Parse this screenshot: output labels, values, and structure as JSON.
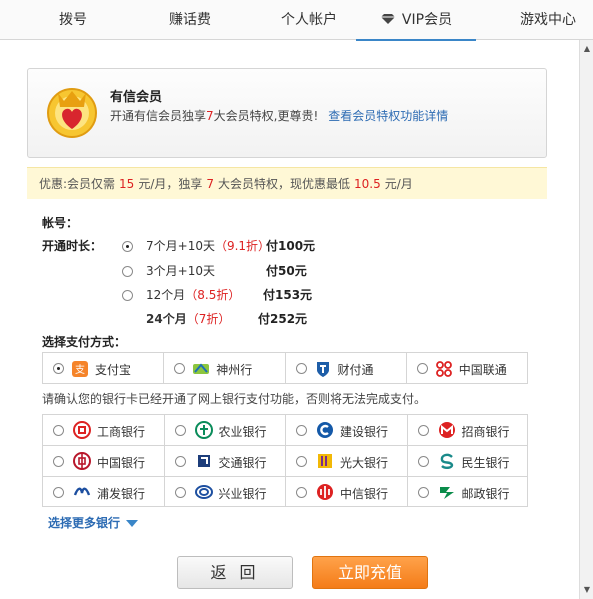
{
  "tabs": [
    {
      "label": "拨号"
    },
    {
      "label": "赚话费"
    },
    {
      "label": "个人帐户"
    },
    {
      "label": "VIP会员",
      "active": true,
      "icon": "diamond-icon"
    },
    {
      "label": "游戏中心"
    }
  ],
  "vip": {
    "title": "有信会员",
    "desc_prefix": "开通有信会员独享",
    "desc_count": "7",
    "desc_suffix": "大会员特权,更尊贵!",
    "link": "查看会员特权功能详情"
  },
  "promo": {
    "p1": "优惠:会员仅需",
    "price": "15",
    "p2": "元/月，独享",
    "count": "7",
    "p3": "大会员特权，现优惠最低",
    "low": "10.5",
    "p4": "元/月"
  },
  "form": {
    "account_label": "帐号：",
    "duration_label": "开通时长：",
    "paymethod_label": "选择支付方式："
  },
  "durations": [
    {
      "text": "7个月+10天",
      "discount": "（9.1折）",
      "pay": "付100元",
      "checked": true
    },
    {
      "text": "3个月+10天",
      "discount": "",
      "pay": "付50元",
      "checked": false
    },
    {
      "text": "12个月",
      "discount": "（8.5折）",
      "pay": "付153元",
      "checked": false
    },
    {
      "text": "24个月",
      "discount": "（7折）",
      "pay": "付252元",
      "checked": false
    }
  ],
  "paymethods": [
    {
      "label": "支付宝",
      "icon": "alipay-icon",
      "checked": true
    },
    {
      "label": "神州行",
      "icon": "shenzhouxing-icon",
      "checked": false
    },
    {
      "label": "财付通",
      "icon": "tenpay-icon",
      "checked": false
    },
    {
      "label": "中国联通",
      "icon": "unicom-icon",
      "checked": false
    }
  ],
  "notice": "请确认您的银行卡已经开通了网上银行支付功能，否则将无法完成支付。",
  "banks": [
    {
      "label": "工商银行",
      "icon": "icbc-icon"
    },
    {
      "label": "农业银行",
      "icon": "abc-icon"
    },
    {
      "label": "建设银行",
      "icon": "ccb-icon"
    },
    {
      "label": "招商银行",
      "icon": "cmb-icon"
    },
    {
      "label": "中国银行",
      "icon": "boc-icon"
    },
    {
      "label": "交通银行",
      "icon": "bocom-icon"
    },
    {
      "label": "光大银行",
      "icon": "ceb-icon"
    },
    {
      "label": "民生银行",
      "icon": "cmbc-icon"
    },
    {
      "label": "浦发银行",
      "icon": "spdb-icon"
    },
    {
      "label": "兴业银行",
      "icon": "cib-icon"
    },
    {
      "label": "中信银行",
      "icon": "citic-icon"
    },
    {
      "label": "邮政银行",
      "icon": "psbc-icon"
    }
  ],
  "more_banks": "选择更多银行",
  "buttons": {
    "back": "返 回",
    "pay": "立即充值"
  },
  "colors": {
    "accent_blue": "#3a86c8",
    "red": "#dd2222",
    "orange": "#f47c18",
    "promo_bg": "#fff8d6"
  }
}
